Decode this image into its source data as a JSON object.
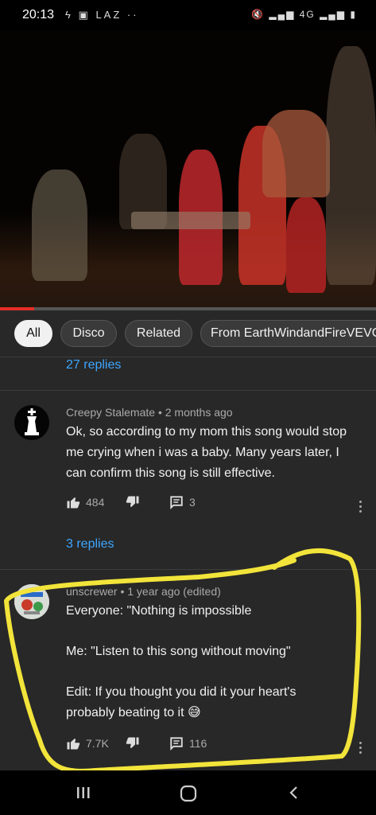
{
  "status_bar": {
    "time": "20:13",
    "left_icons": [
      "messenger-icon",
      "gallery-icon",
      "LAZ",
      "more-dots"
    ],
    "left_label": "LAZ",
    "right_icons": [
      "mute-icon",
      "signal-icon",
      "4g-icon",
      "signal-icon",
      "battery-icon"
    ]
  },
  "video": {
    "progress_fraction": 0.09
  },
  "chips": [
    {
      "label": "All",
      "active": true
    },
    {
      "label": "Disco",
      "active": false
    },
    {
      "label": "Related",
      "active": false
    },
    {
      "label": "From EarthWindandFireVEVO",
      "active": false
    }
  ],
  "comments": {
    "prev_replies": "27 replies",
    "items": [
      {
        "author": "Creepy Stalemate",
        "time": "2 months ago",
        "meta": "Creepy Stalemate • 2 months ago",
        "text": "Ok, so according to my mom this song would stop me crying when i was a baby. Many years later, I can confirm this song is still effective.",
        "likes": "484",
        "comment_count": "3",
        "replies": "3 replies"
      },
      {
        "author": "unscrewer",
        "time": "1 year ago (edited)",
        "meta": "unscrewer • 1 year ago (edited)",
        "text_lines": [
          "Everyone: \"Nothing is impossible",
          "Me: \"Listen to this song without moving\"",
          "Edit: If you thought you did it your heart's probably beating to it 😅"
        ],
        "likes": "7.7K",
        "comment_count": "116"
      }
    ]
  },
  "colors": {
    "background": "#282828",
    "link": "#3ea6ff",
    "progress": "#e52d27",
    "highlight": "#f2e43a"
  },
  "nav_bar": {
    "icons": [
      "recents-icon",
      "home-icon",
      "back-icon"
    ]
  }
}
